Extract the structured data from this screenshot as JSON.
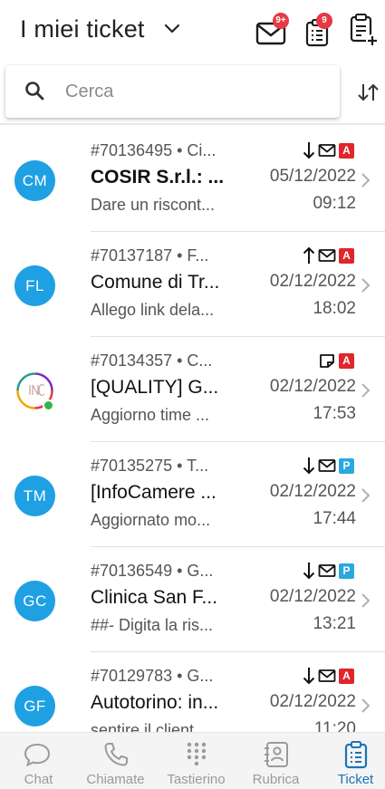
{
  "header": {
    "title": "I miei ticket",
    "mail_badge": "9+",
    "tasks_badge": "9",
    "colors": {
      "badge": "#e53945",
      "icon": "#1c1c1c"
    }
  },
  "search": {
    "placeholder": "Cerca",
    "value": ""
  },
  "tickets": [
    {
      "id": "#70136495 • Ci...",
      "subject": "COSIR S.r.l.: ...",
      "preview": "Dare un riscont...",
      "date": "05/12/2022",
      "time": "09:12",
      "avatar": "CM",
      "arrow": "down",
      "extra_icon": "mail",
      "tag": "A",
      "bold": true
    },
    {
      "id": "#70137187 • F...",
      "subject": "Comune di Tr...",
      "preview": "Allego link dela...",
      "date": "02/12/2022",
      "time": "18:02",
      "avatar": "FL",
      "arrow": "up",
      "extra_icon": "mail",
      "tag": "A",
      "bold": false
    },
    {
      "id": "#70134357 • C...",
      "subject": "[QUALITY] G...",
      "preview": "Aggiorno time ...",
      "date": "02/12/2022",
      "time": "17:53",
      "avatar": "",
      "arrow": "none",
      "extra_icon": "note",
      "tag": "A",
      "bold": false
    },
    {
      "id": "#70135275 • T...",
      "subject": "[InfoCamere ...",
      "preview": "Aggiornato mo...",
      "date": "02/12/2022",
      "time": "17:44",
      "avatar": "TM",
      "arrow": "down",
      "extra_icon": "mail",
      "tag": "P",
      "bold": false
    },
    {
      "id": "#70136549 • G...",
      "subject": "Clinica San F...",
      "preview": "##- Digita la ris...",
      "date": "02/12/2022",
      "time": "13:21",
      "avatar": "GC",
      "arrow": "down",
      "extra_icon": "mail",
      "tag": "P",
      "bold": false
    },
    {
      "id": "#70129783 • G...",
      "subject": "Autotorino: in...",
      "preview": "sentire il client...",
      "date": "02/12/2022",
      "time": "11:20",
      "avatar": "GF",
      "arrow": "down",
      "extra_icon": "mail",
      "tag": "A",
      "bold": false
    }
  ],
  "tag_colors": {
    "A": "#e0262c",
    "P": "#2aa8e0"
  },
  "avatar_color": "#1fa0e3",
  "nav": {
    "items": [
      {
        "label": "Chat",
        "icon": "chat-icon"
      },
      {
        "label": "Chiamate",
        "icon": "phone-icon"
      },
      {
        "label": "Tastierino",
        "icon": "dialpad-icon"
      },
      {
        "label": "Rubrica",
        "icon": "contacts-icon"
      },
      {
        "label": "Ticket",
        "icon": "ticket-icon"
      }
    ],
    "active": "Ticket",
    "active_color": "#1a74b7"
  }
}
